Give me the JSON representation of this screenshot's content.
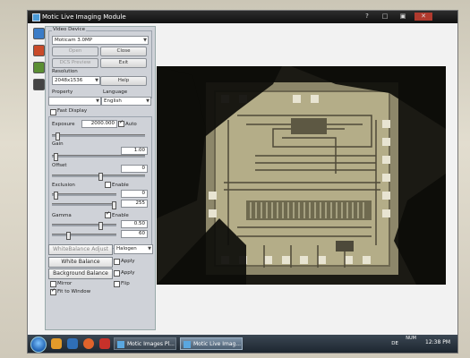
{
  "window": {
    "title": "Motic Live Imaging Module",
    "buttons": [
      "?",
      "□",
      "▣",
      "✕"
    ]
  },
  "vtoolbar": {
    "icons": [
      {
        "name": "camera-icon",
        "color": "#3a7cc7"
      },
      {
        "name": "settings-icon",
        "color": "#c94b2a"
      },
      {
        "name": "image-icon",
        "color": "#5b8f34"
      },
      {
        "name": "capture-icon",
        "color": "#444444"
      }
    ]
  },
  "panel": {
    "video_device_label": "Video Device",
    "video_device_value": "Moticam 3.0MP",
    "open_label": "Open",
    "close_label": "Close",
    "dcs_preview_label": "DCS Preview",
    "exit_label": "Exit",
    "resolution_label": "Resolution",
    "resolution_value": "2048x1536",
    "help_label": "Help",
    "property_label": "Property",
    "property_value": "",
    "language_label": "Language",
    "language_value": "English",
    "fast_display_label": "Fast Display",
    "exposure_label": "Exposure",
    "exposure_value": "2000.000",
    "auto_label": "Auto",
    "gain_label": "Gain",
    "gain_value": "1.00",
    "offset_label": "Offset",
    "offset_value": "0",
    "exclusion_label": "Exclusion",
    "exclusion_enable_label": "Enable",
    "exclusion_low": "0",
    "exclusion_high": "255",
    "gamma_label": "Gamma",
    "gamma_enable_label": "Enable",
    "gamma_value1": "0.50",
    "gamma_value2": "60",
    "white_balance_adjust_label": "WhiteBalance Adjust",
    "light_source_value": "Halogen",
    "white_balance_label": "White Balance",
    "apply_label": "Apply",
    "background_balance_label": "Background Balance",
    "apply2_label": "Apply",
    "mirror_label": "Mirror",
    "flip_label": "Flip",
    "fit_to_window_label": "Fit to Window"
  },
  "taskbar": {
    "tasks": [
      {
        "label": "Motic Images Pl..."
      },
      {
        "label": "Motic Live Imag..."
      }
    ],
    "tray_text": "NUM",
    "language": "DE",
    "time": "12:38 PM"
  }
}
